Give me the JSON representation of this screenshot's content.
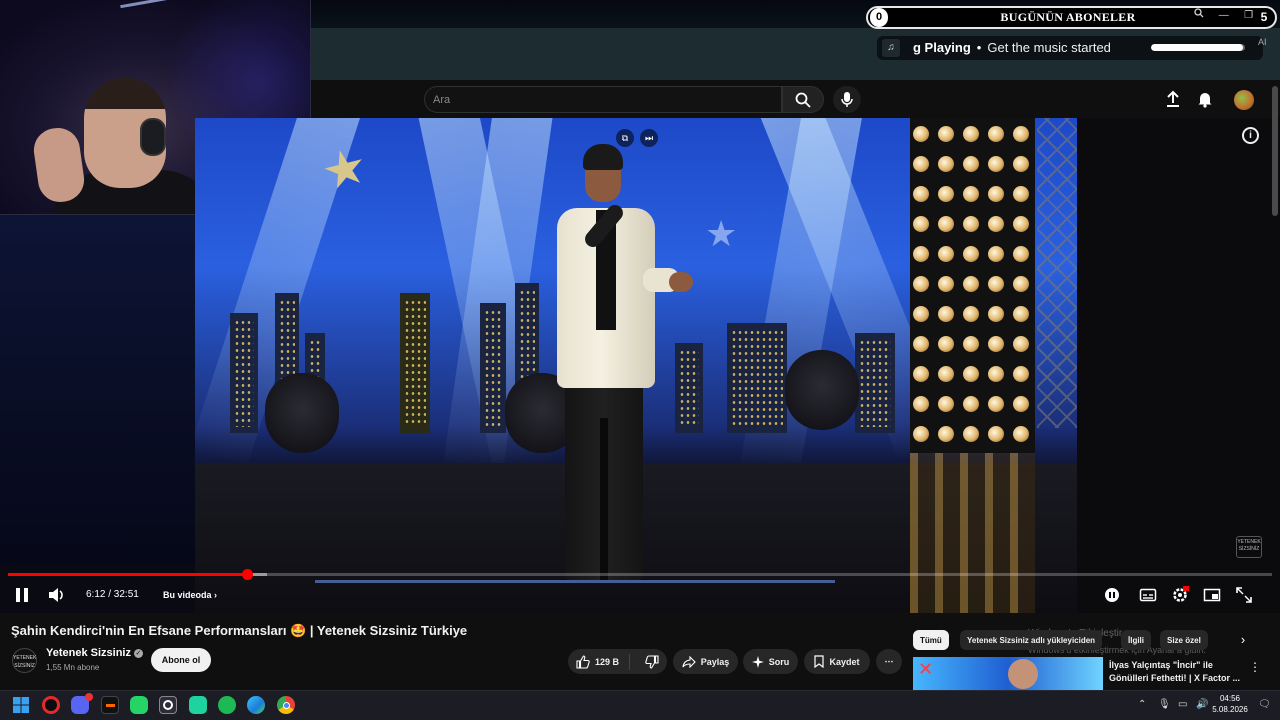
{
  "widget": {
    "subscribers_title": "BUGÜNÜN ABONELER",
    "left_count": "0",
    "right_count": "5"
  },
  "now_playing": {
    "label": "g Playing",
    "dot": "•",
    "text": "Get the music started",
    "progress": 0.98,
    "tag": "AI"
  },
  "search": {
    "placeholder": "Ara"
  },
  "player": {
    "time": "6:12 / 32:51",
    "chapter": "Bu videoda",
    "progress": 0.189,
    "buffered": 0.205
  },
  "video": {
    "title": "Şahin Kendirci'nin En Efsane Performansları 🤩 | Yetenek Sizsiniz Türkiye",
    "watermark": "YETENEK SİZSİNİZ"
  },
  "channel": {
    "name": "Yetenek Sizsiniz",
    "subscribers": "1,55 Mn abone",
    "logo_text": "YETENEK SİZSİNİZ",
    "subscribe_label": "Abone ol"
  },
  "actions": {
    "likes": "129 B",
    "share": "Paylaş",
    "ask": "Soru",
    "save": "Kaydet"
  },
  "chips": [
    "Tümü",
    "Yetenek Sizsiniz adlı yükleyiciden",
    "İlgili",
    "Size özel"
  ],
  "recommended": {
    "title": "İlyas Yalçıntaş \"İncir\" ile Gönülleri Fethetti! | X Factor ..."
  },
  "windows": {
    "activate_line1": "Windows'u Etkinleştir",
    "activate_line2": "Windows'u etkinleştirmek için Ayarlar'a gidin."
  },
  "taskbar": {
    "time": "04:56",
    "date": "5.08.2026"
  },
  "colors": {
    "accent_red": "#ff0000",
    "yt_background": "#0f0f0f",
    "pill_background": "#272727"
  }
}
